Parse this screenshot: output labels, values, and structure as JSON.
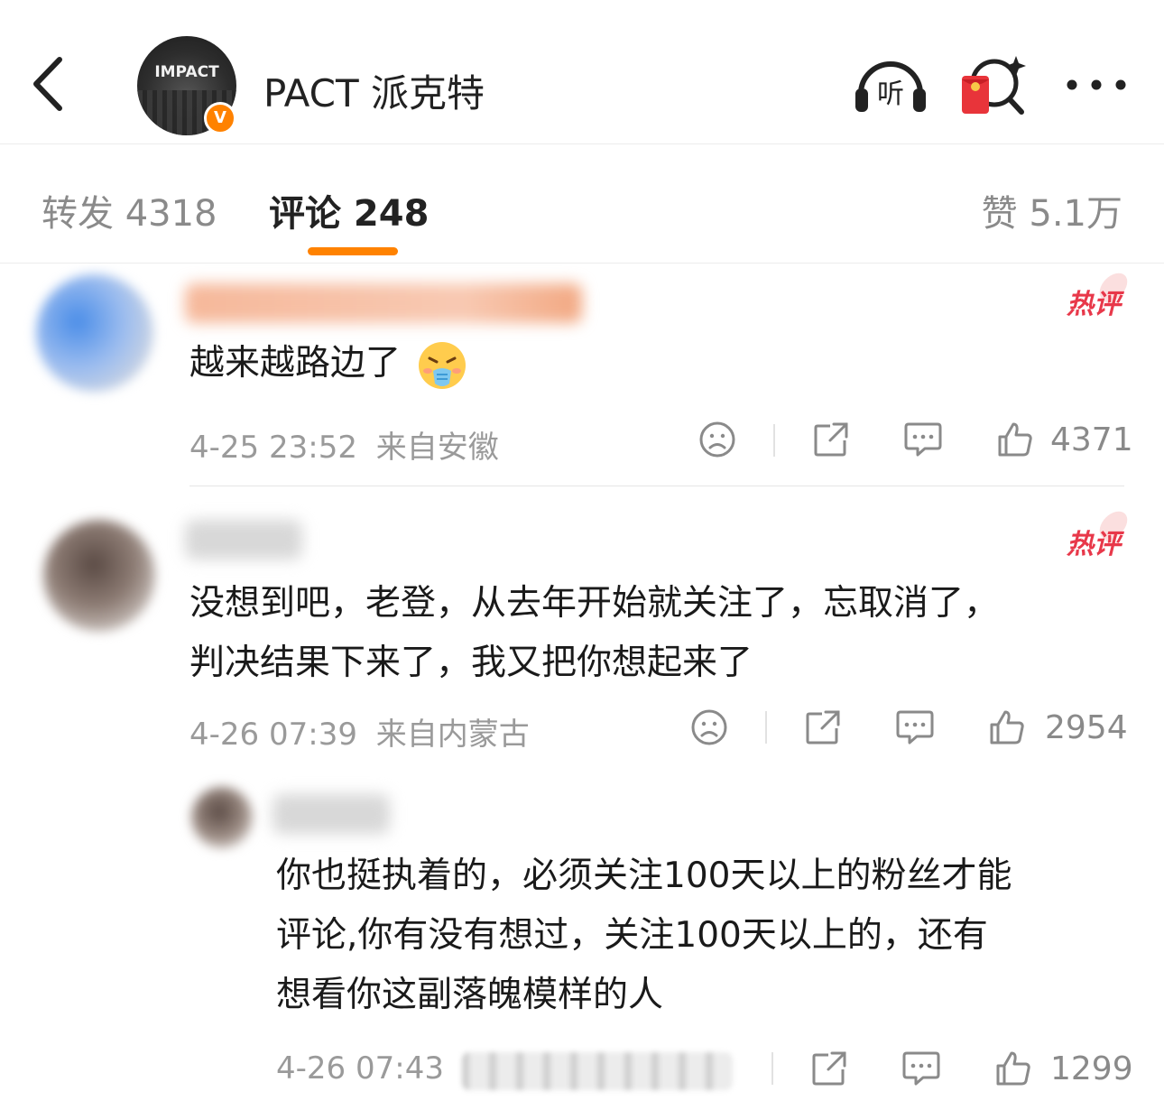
{
  "header": {
    "title": "PACT 派克特",
    "avatar_logo_text": "IMPACT",
    "verify_badge": "V",
    "listen_label": "听"
  },
  "tabs": [
    {
      "label": "转发 4318"
    },
    {
      "label": "评论 248"
    },
    {
      "label": "赞 5.1万"
    }
  ],
  "comments": [
    {
      "hot_label": "热评",
      "text": "越来越路边了",
      "time": "4-25 23:52",
      "location": "来自安徽",
      "likes": "4371"
    },
    {
      "hot_label": "热评",
      "text_line1": "没想到吧，老登，从去年开始就关注了，忘取消了，",
      "text_line2": "判决结果下来了，我又把你想起来了",
      "time": "4-26 07:39",
      "location": "来自内蒙古",
      "likes": "2954"
    },
    {
      "text_line1": "你也挺执着的，必须关注100天以上的粉丝才能",
      "text_line2": "评论,你有没有想过，关注100天以上的，还有",
      "text_line3": "想看你这副落魄模样的人",
      "time": "4-26 07:43",
      "likes": "1299"
    }
  ],
  "colors": {
    "accent": "#ff8200",
    "hot": "#e8384a",
    "meta": "#9a9a9a"
  },
  "icons": [
    "back-arrow-icon",
    "headphones-icon",
    "red-packet-icon",
    "more-icon",
    "dislike-face-icon",
    "share-icon",
    "comment-bubble-icon",
    "thumbs-up-icon",
    "nauseated-face-icon"
  ]
}
